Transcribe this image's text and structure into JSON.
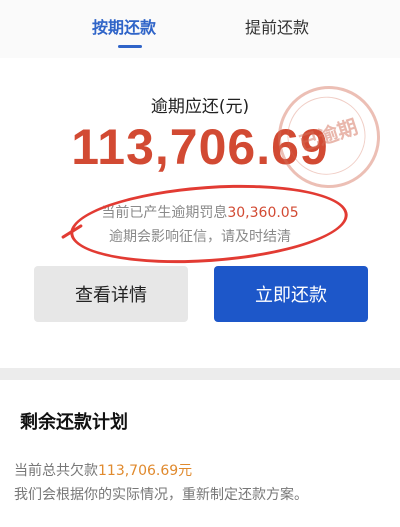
{
  "tabs": [
    {
      "label": "按期还款",
      "active": true
    },
    {
      "label": "提前还款",
      "active": false
    }
  ],
  "overdue": {
    "label": "逾期应还(元)",
    "amount": "113,706.69",
    "notice_prefix": "当前已产生逾期罚息",
    "penalty": "30,360.05",
    "notice_line2": "逾期会影响征信，请及时结清"
  },
  "stamp": {
    "text": "已逾期"
  },
  "buttons": {
    "detail": "查看详情",
    "pay": "立即还款"
  },
  "plan": {
    "title": "剩余还款计划",
    "owed_prefix": "当前总共欠款",
    "owed_amount": "113,706.69元",
    "note": "我们会根据你的实际情况，重新制定还款方案。"
  },
  "colors": {
    "accent": "#2f64c8",
    "primary_button": "#1d57c9",
    "amount_red": "#d24a33",
    "owed_orange": "#e08a2e",
    "annotation_red": "#e23b33"
  }
}
